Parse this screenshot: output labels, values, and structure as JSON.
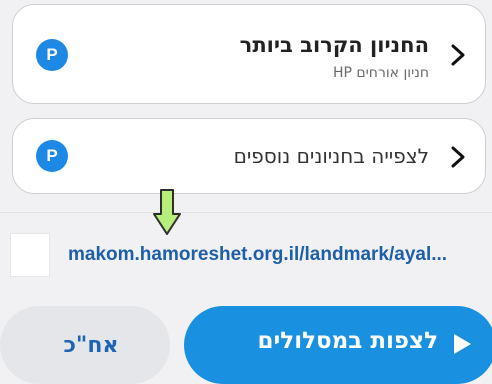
{
  "nearest_parking": {
    "title": "החניון הקרוב ביותר",
    "subtitle": "חניון אורחים HP",
    "icon": "parking-icon",
    "icon_letter": "P",
    "chevron_icon": "chevron-right-icon"
  },
  "more_parking": {
    "title": "לצפייה בחניונים נוספים",
    "icon": "parking-icon",
    "icon_letter": "P",
    "chevron_icon": "chevron-right-icon"
  },
  "link": {
    "text": "makom.hamoreshet.org.il/landmark/ayal..."
  },
  "annotation": {
    "icon": "green-down-arrow-icon"
  },
  "actions": {
    "later_label": "אח\"כ",
    "routes_label": "לצפות במסלולים",
    "routes_icon": "play-icon"
  },
  "colors": {
    "accent_blue": "#1a91e0",
    "link_blue": "#1f5fa8",
    "parking_icon": "#1e88e5",
    "arrow_green": "#b6f07a",
    "later_bg": "#e5e6ea"
  }
}
